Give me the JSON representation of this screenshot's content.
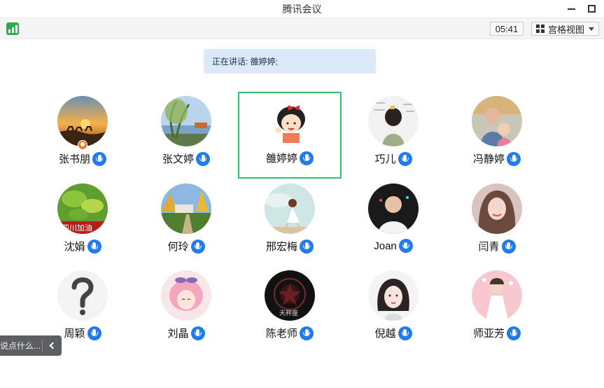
{
  "window": {
    "title": "腾讯会议"
  },
  "toolbar": {
    "timer": "05:41",
    "view_label": "宫格视图"
  },
  "speaking": {
    "text": "正在讲话: 雒婷婷;"
  },
  "participants": [
    {
      "name": "张书朋",
      "avatar": "desert-sunset-camels",
      "host": true
    },
    {
      "name": "张文婷",
      "avatar": "lake-willow-tree"
    },
    {
      "name": "雒婷婷",
      "avatar": "cartoon-girl-red-bow",
      "active": true
    },
    {
      "name": "巧儿",
      "avatar": "woman-back-sketch"
    },
    {
      "name": "冯静婷",
      "avatar": "mother-with-baby"
    },
    {
      "name": "沈娟",
      "avatar": "green-leaves-slogan"
    },
    {
      "name": "何玲",
      "avatar": "park-path-autumn"
    },
    {
      "name": "邢宏梅",
      "avatar": "girl-sitting-sky"
    },
    {
      "name": "Joan",
      "avatar": "girl-portrait-dark"
    },
    {
      "name": "闫青",
      "avatar": "woman-selfie-pink"
    },
    {
      "name": "周颖",
      "avatar": "question-mark-words"
    },
    {
      "name": "刘晶",
      "avatar": "pink-hair-anime-girl"
    },
    {
      "name": "陈老师",
      "avatar": "dark-emblem-badge"
    },
    {
      "name": "倪越",
      "avatar": "illustrated-girl-bob"
    },
    {
      "name": "师亚芳",
      "avatar": "girl-white-dress"
    }
  ],
  "chat": {
    "hint": "说点什么..."
  },
  "colors": {
    "mic": "#1f7cf0",
    "active_border": "#2fc267",
    "speaking_bg": "#dbe9fb",
    "signal": "#2faa4c",
    "host_badge": "#f27a2b"
  }
}
